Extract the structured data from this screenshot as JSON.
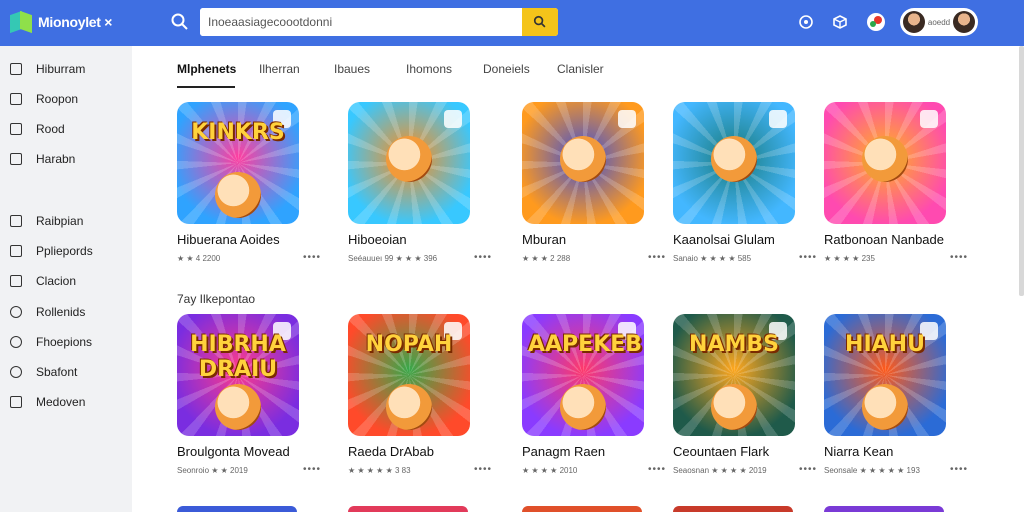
{
  "app": {
    "logo_text": "Mionoylet ×",
    "brand_color": "#3f6fe2",
    "accent_color": "#f4c41a"
  },
  "search": {
    "value": "Inoeaasiagecoootdonni",
    "placeholder": ""
  },
  "header_icons": [
    "search-icon",
    "notification-icon",
    "puzzle-icon",
    "color-icon"
  ],
  "user": {
    "name": "aoedd"
  },
  "sidebar": {
    "items": [
      {
        "label": "Hiburram",
        "icon": "home-icon"
      },
      {
        "label": "Roopon",
        "icon": "bookmark-icon"
      },
      {
        "label": "Rood",
        "icon": "square-icon"
      },
      {
        "label": "Harabn",
        "icon": "square-icon"
      },
      {
        "label": "Raibpian",
        "icon": "grid-icon"
      },
      {
        "label": "Ppliepords",
        "icon": "grid-icon"
      },
      {
        "label": "Clacion",
        "icon": "box-icon"
      },
      {
        "label": "Rollenids",
        "icon": "circle-icon"
      },
      {
        "label": "Fhoepions",
        "icon": "circle-icon"
      },
      {
        "label": "Sbafont",
        "icon": "link-icon"
      },
      {
        "label": "Medoven",
        "icon": "bag-icon"
      }
    ]
  },
  "tabs": [
    {
      "label": "Mlphenets",
      "active": true
    },
    {
      "label": "Ilherran",
      "active": false
    },
    {
      "label": "Ibaues",
      "active": false
    },
    {
      "label": "Ihomons",
      "active": false
    },
    {
      "label": "Doneiels",
      "active": false
    },
    {
      "label": "Clanisler",
      "active": false
    }
  ],
  "section_label": "7ay Ilkepontao",
  "games_row1": [
    {
      "title": "Hibuerana Aoides",
      "meta": "★ ★ 4 2200",
      "art": "KINKRS",
      "colors": [
        "#2fa3ff",
        "#ff3fa0"
      ]
    },
    {
      "title": "Hiboeoian",
      "meta": "Seéauueı 99  ★ ★ ★ 396",
      "art": "",
      "colors": [
        "#38c8ff",
        "#ff8c1a"
      ]
    },
    {
      "title": "Mburan",
      "meta": "★ ★ ★ 2 288",
      "art": "",
      "colors": [
        "#ff9a1e",
        "#3d4fd6"
      ]
    },
    {
      "title": "Kaanolsai Glulam",
      "meta": "Sanaio  ★ ★ ★ ★ 585",
      "art": "",
      "colors": [
        "#43b7ff",
        "#1a7a7a"
      ]
    },
    {
      "title": "Ratbonoan Nanbade",
      "meta": "★ ★ ★ ★ 235",
      "art": "",
      "colors": [
        "#ff4ab0",
        "#ffb21e"
      ]
    }
  ],
  "games_row2": [
    {
      "title": "Broulgonta Movead",
      "meta": "Seonroio   ★ ★ 2019",
      "art": "HIBRHA DRAIU",
      "colors": [
        "#7a2de0",
        "#ff3a8a"
      ]
    },
    {
      "title": "Raeda DrAbab",
      "meta": "★ ★ ★ ★ ★ 3 83",
      "art": "NOPAH",
      "colors": [
        "#ff4a2a",
        "#38a84a"
      ]
    },
    {
      "title": "Panagm Raen",
      "meta": "★ ★ ★ ★ 2010",
      "art": "AAPEKEB",
      "colors": [
        "#8a3bff",
        "#ff3a6a"
      ]
    },
    {
      "title": "Ceountaen Flark",
      "meta": "Seaosnan  ★ ★ ★ ★ 2019",
      "art": "NAMBS",
      "colors": [
        "#1f5a4a",
        "#ffa71e"
      ]
    },
    {
      "title": "Niarra Kean",
      "meta": "Seonsale  ★ ★ ★ ★ ★ 193",
      "art": "HIAHU",
      "colors": [
        "#2b6bd6",
        "#ff5a1a"
      ]
    }
  ]
}
